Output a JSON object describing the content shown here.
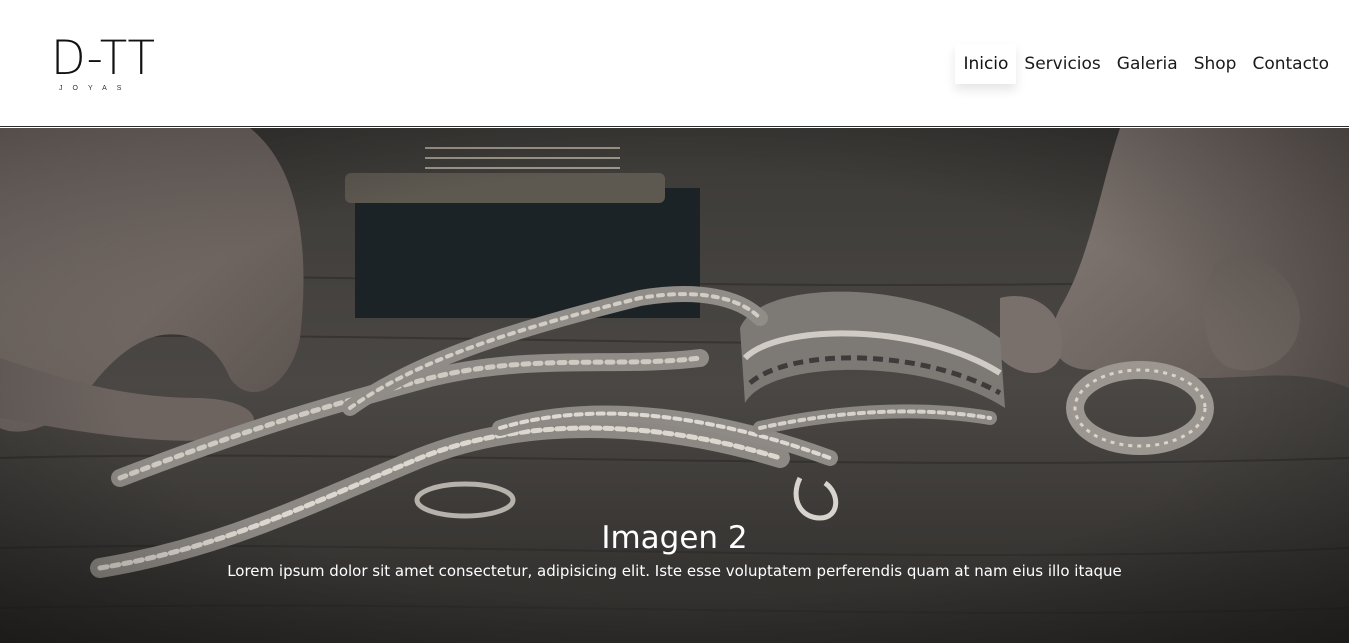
{
  "brand": {
    "logo_text": "D-TT",
    "logo_subtext": "JOYAS"
  },
  "nav": {
    "items": [
      {
        "label": "Inicio",
        "active": true
      },
      {
        "label": "Servicios",
        "active": false
      },
      {
        "label": "Galeria",
        "active": false
      },
      {
        "label": "Shop",
        "active": false
      },
      {
        "label": "Contacto",
        "active": false
      }
    ]
  },
  "hero": {
    "caption_title": "Imagen 2",
    "caption_text": "Lorem ipsum dolor sit amet consectetur, adipisicing elit. Iste esse voluptatem perferendis quam at nam eius illo itaque"
  },
  "colors": {
    "header_bg": "#ffffff",
    "text": "#1a1a1a",
    "caption_text": "#ffffff"
  }
}
